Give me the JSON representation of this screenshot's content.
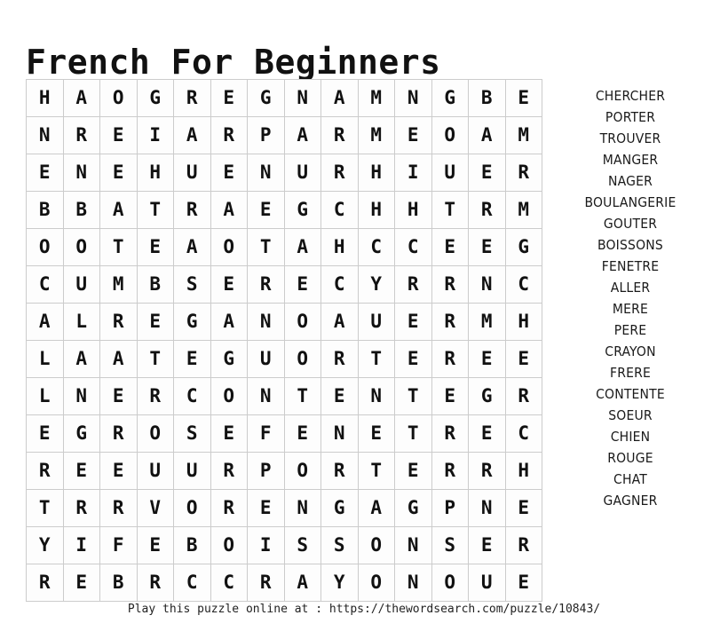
{
  "title": "French For Beginners",
  "grid": {
    "rows": 14,
    "cols": 14,
    "letters": [
      [
        "H",
        "A",
        "O",
        "G",
        "R",
        "E",
        "G",
        "N",
        "A",
        "M",
        "N",
        "G",
        "B",
        "E"
      ],
      [
        "N",
        "R",
        "E",
        "I",
        "A",
        "R",
        "P",
        "A",
        "R",
        "M",
        "E",
        "O",
        "A",
        "M"
      ],
      [
        "E",
        "N",
        "E",
        "H",
        "U",
        "E",
        "N",
        "U",
        "R",
        "H",
        "I",
        "U",
        "E",
        "R"
      ],
      [
        "B",
        "B",
        "A",
        "T",
        "R",
        "A",
        "E",
        "G",
        "C",
        "H",
        "H",
        "T",
        "R",
        "M"
      ],
      [
        "O",
        "O",
        "T",
        "E",
        "A",
        "O",
        "T",
        "A",
        "H",
        "C",
        "C",
        "E",
        "E",
        "G"
      ],
      [
        "C",
        "U",
        "M",
        "B",
        "S",
        "E",
        "R",
        "E",
        "C",
        "Y",
        "R",
        "R",
        "N",
        "C"
      ],
      [
        "A",
        "L",
        "R",
        "E",
        "G",
        "A",
        "N",
        "O",
        "A",
        "U",
        "E",
        "R",
        "M",
        "H"
      ],
      [
        "L",
        "A",
        "A",
        "T",
        "E",
        "G",
        "U",
        "O",
        "R",
        "T",
        "E",
        "R",
        "E",
        "E"
      ],
      [
        "L",
        "N",
        "E",
        "R",
        "C",
        "O",
        "N",
        "T",
        "E",
        "N",
        "T",
        "E",
        "G",
        "R"
      ],
      [
        "E",
        "G",
        "R",
        "O",
        "S",
        "E",
        "F",
        "E",
        "N",
        "E",
        "T",
        "R",
        "E",
        "C"
      ],
      [
        "R",
        "E",
        "E",
        "U",
        "U",
        "R",
        "P",
        "O",
        "R",
        "T",
        "E",
        "R",
        "R",
        "H"
      ],
      [
        "T",
        "R",
        "R",
        "V",
        "O",
        "R",
        "E",
        "N",
        "G",
        "A",
        "G",
        "P",
        "N",
        "E"
      ],
      [
        "Y",
        "I",
        "F",
        "E",
        "B",
        "O",
        "I",
        "S",
        "S",
        "O",
        "N",
        "S",
        "E",
        "R"
      ],
      [
        "R",
        "E",
        "B",
        "R",
        "C",
        "C",
        "R",
        "A",
        "Y",
        "O",
        "N",
        "O",
        "U",
        "E"
      ]
    ]
  },
  "words": [
    "CHERCHER",
    "PORTER",
    "TROUVER",
    "MANGER",
    "NAGER",
    "BOULANGERIE",
    "GOUTER",
    "BOISSONS",
    "FENETRE",
    "ALLER",
    "MERE",
    "PERE",
    "CRAYON",
    "FRERE",
    "CONTENTE",
    "SOEUR",
    "CHIEN",
    "ROUGE",
    "CHAT",
    "GAGNER"
  ],
  "footer": "Play this puzzle online at : https://thewordsearch.com/puzzle/10843/",
  "colors": {
    "page_background": "#ffffff",
    "grid_line": "#cccccc",
    "cell_background": "#fdfdfd",
    "text": "#111111"
  }
}
